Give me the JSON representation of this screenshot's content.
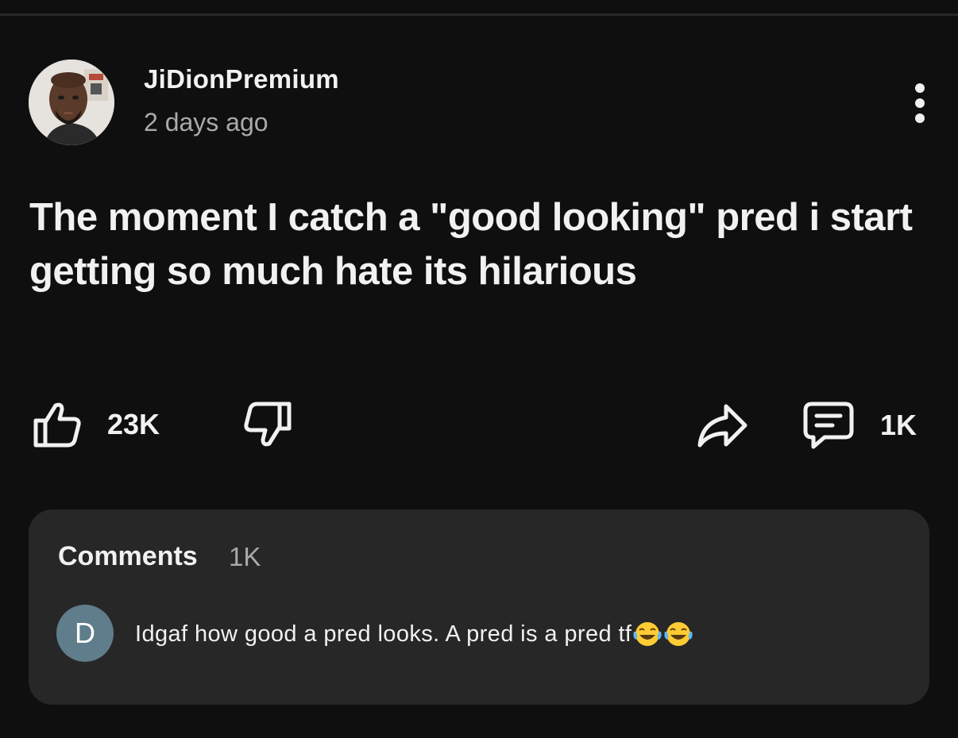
{
  "post": {
    "author": "JiDionPremium",
    "time": "2 days ago",
    "text": "The moment I catch a \"good looking\" pred i start getting so much hate its hilarious",
    "more_icon": "more-vertical-icon"
  },
  "actions": {
    "like_icon": "thumbs-up-icon",
    "like_count": "23K",
    "dislike_icon": "thumbs-down-icon",
    "share_icon": "share-icon",
    "comment_icon": "comment-icon",
    "comment_count": "1K"
  },
  "comments": {
    "heading": "Comments",
    "count": "1K",
    "preview": {
      "avatar_initial": "D",
      "avatar_color": "#607d8b",
      "text": "Idgaf how good a pred looks. A pred is a pred tf",
      "emojis": [
        "face-with-tears-of-joy-icon",
        "face-with-tears-of-joy-icon"
      ]
    }
  },
  "colors": {
    "background": "#0f0f0f",
    "card": "#272727",
    "text_primary": "#f1f1f1",
    "text_secondary": "#aaaaaa"
  }
}
